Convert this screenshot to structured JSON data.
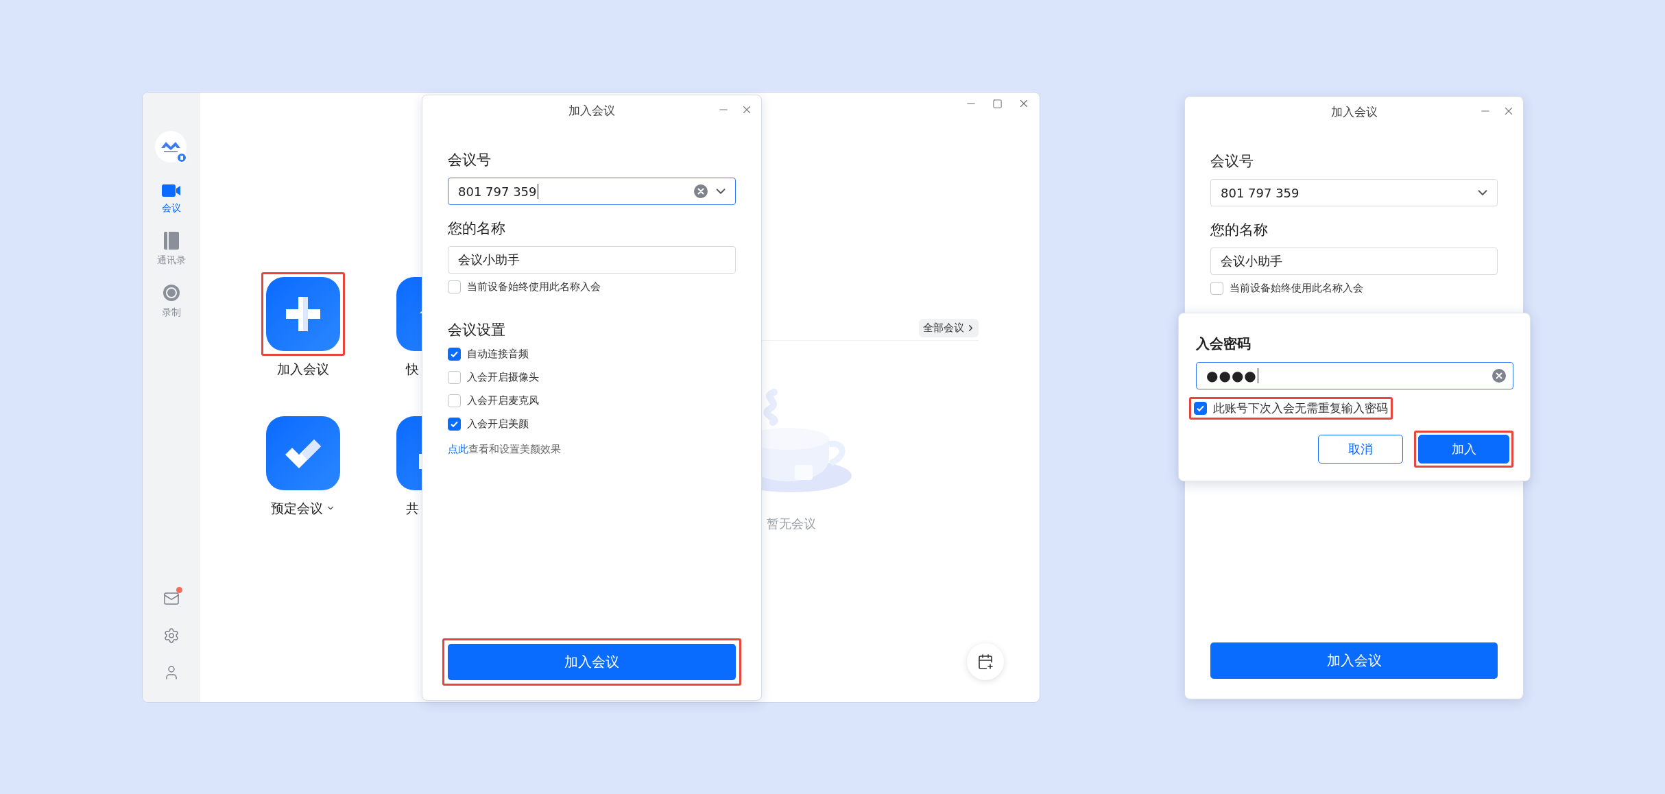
{
  "main_window": {
    "sidebar": {
      "items": [
        {
          "kind": "meetings",
          "label": "会议",
          "selected": true
        },
        {
          "kind": "contacts",
          "label": "通讯录",
          "selected": false
        },
        {
          "kind": "recordings",
          "label": "录制",
          "selected": false
        }
      ],
      "mail_unread": true
    },
    "tiles": [
      {
        "kind": "join",
        "label": "加入会议",
        "highlighted": true,
        "dropdown": false
      },
      {
        "kind": "quick",
        "label": "快",
        "highlighted": false,
        "dropdown": false
      },
      {
        "kind": "schedule",
        "label": "预定会议",
        "highlighted": false,
        "dropdown": true
      },
      {
        "kind": "share",
        "label": "共",
        "highlighted": false,
        "dropdown": false
      }
    ],
    "all_meetings_button": "全部会议",
    "empty_text": "暂无会议"
  },
  "join_dialog": {
    "title": "加入会议",
    "meeting_id_label": "会议号",
    "meeting_id": {
      "value": "801 797 359",
      "focused": true
    },
    "name_label": "您的名称",
    "name": "会议小助手",
    "remember_name": {
      "label": "当前设备始终使用此名称入会",
      "checked": false
    },
    "settings_title": "会议设置",
    "options": [
      {
        "label": "自动连接音频",
        "checked": true
      },
      {
        "label": "入会开启摄像头",
        "checked": false
      },
      {
        "label": "入会开启麦克风",
        "checked": false
      },
      {
        "label": "入会开启美颜",
        "checked": true
      }
    ],
    "beauty_hint": {
      "link": "点此",
      "text": "查看和设置美颜效果"
    },
    "submit": {
      "label": "加入会议",
      "highlighted": true
    }
  },
  "password_dialog": {
    "title": "加入会议",
    "meeting_id_label": "会议号",
    "meeting_id": {
      "value": "801 797 359",
      "focused": false
    },
    "name_label": "您的名称",
    "name": "会议小助手",
    "remember_name": {
      "label": "当前设备始终使用此名称入会",
      "checked": false
    },
    "submit": {
      "label": "加入会议",
      "highlighted": false
    },
    "password_popup": {
      "title": "入会密码",
      "value": "●●●●",
      "remember": {
        "label": "此账号下次入会无需重复输入密码",
        "checked": true,
        "highlighted": true
      },
      "buttons": [
        {
          "kind": "secondary",
          "label": "取消",
          "highlighted": false
        },
        {
          "kind": "primary",
          "label": "加入",
          "highlighted": true
        }
      ]
    }
  }
}
